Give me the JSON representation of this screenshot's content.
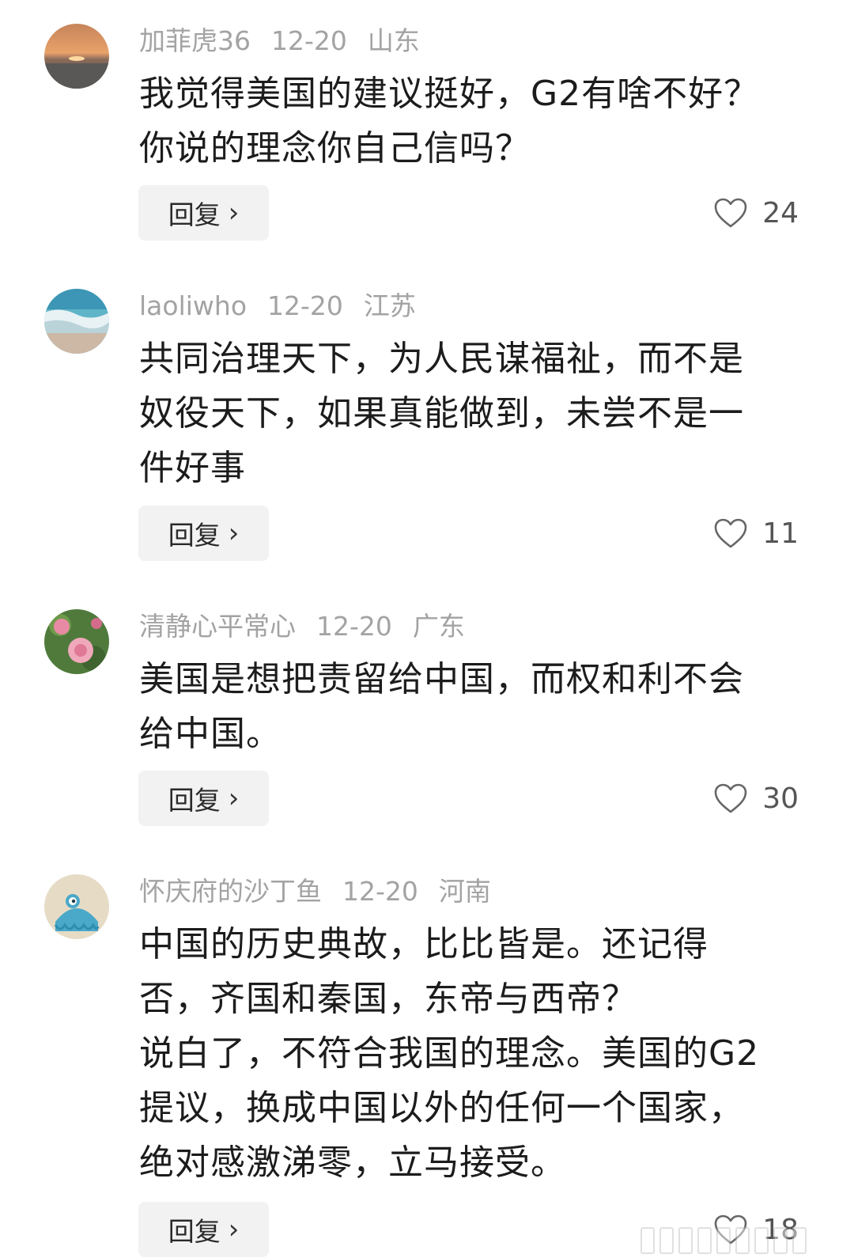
{
  "reply_label": "回复",
  "comments": [
    {
      "username": "加菲虎36",
      "date": "12-20",
      "location": "山东",
      "text": "我觉得美国的建议挺好，G2有啥不好？\n你说的理念你自己信吗？",
      "likes": "24"
    },
    {
      "username": "laoliwho",
      "date": "12-20",
      "location": "江苏",
      "text": "共同治理天下，为人民谋福祉，而不是\n奴役天下，如果真能做到，未尝不是一\n件好事",
      "likes": "11"
    },
    {
      "username": "清静心平常心",
      "date": "12-20",
      "location": "广东",
      "text": "美国是想把责留给中国，而权和利不会\n给中国。",
      "likes": "30"
    },
    {
      "username": "怀庆府的沙丁鱼",
      "date": "12-20",
      "location": "河南",
      "text": "中国的历史典故，比比皆是。还记得\n否，齐国和秦国，东帝与西帝？\n说白了，不符合我国的理念。美国的G2\n提议，换成中国以外的任何一个国家，\n绝对感激涕零，立马接受。",
      "likes": "18"
    }
  ],
  "icons": {
    "like": "heart-outline-icon",
    "chevron": "chevron-right-icon"
  }
}
